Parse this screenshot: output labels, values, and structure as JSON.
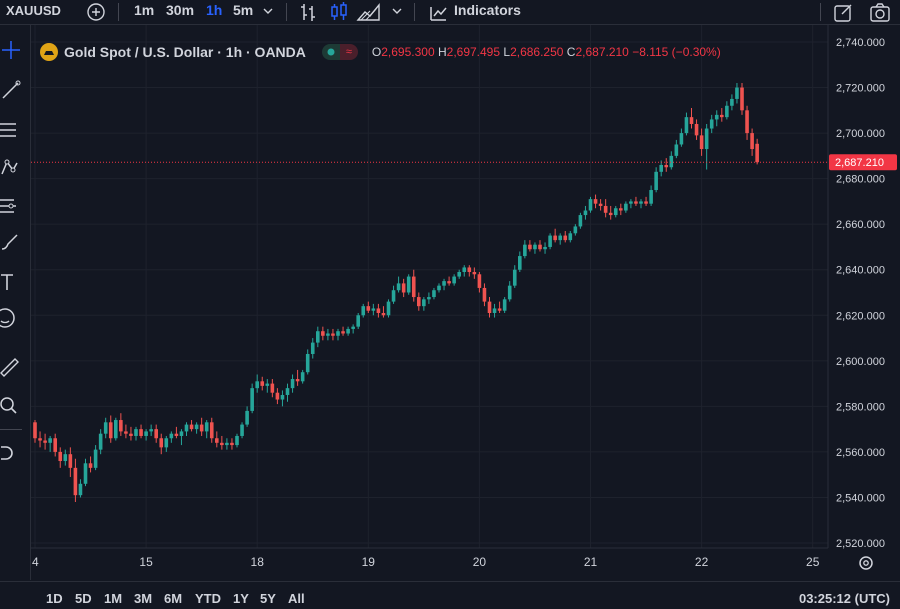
{
  "toolbar": {
    "symbol": "XAUUSD",
    "intervals": [
      "1m",
      "30m",
      "1h",
      "5m"
    ],
    "active_interval": "1h",
    "indicators_label": "Indicators"
  },
  "sidebar": {
    "icons": [
      "crosshair-icon",
      "trend-line-icon",
      "fib-icon",
      "pattern-icon",
      "prediction-icon",
      "brush-icon",
      "text-icon",
      "emoji-icon",
      "ruler-icon",
      "zoom-icon",
      "magnet-icon"
    ]
  },
  "legend": {
    "title": "Gold Spot / U.S. Dollar · 1h · OANDA",
    "o_label": "O",
    "o_value": "2,695.300",
    "h_label": "H",
    "h_value": "2,697.495",
    "l_label": "L",
    "l_value": "2,686.250",
    "c_label": "C",
    "c_value": "2,687.210",
    "change": "−8.115 (−0.30%)",
    "pill_b": "≈"
  },
  "bottom": {
    "ranges": [
      "1D",
      "5D",
      "1M",
      "3M",
      "6M",
      "YTD",
      "1Y",
      "5Y",
      "All"
    ],
    "clock": "03:25:12 (UTC)"
  },
  "colors": {
    "background": "#131722",
    "up": "#26a69a",
    "down": "#ef5350",
    "price_label": "#f23645",
    "text": "#d1d4dc",
    "grid": "#1e222d"
  },
  "chart_data": {
    "type": "candlestick",
    "title": "Gold Spot / U.S. Dollar · 1h · OANDA",
    "ylim": [
      2515,
      2745
    ],
    "y_ticks": [
      2520,
      2540,
      2560,
      2580,
      2600,
      2620,
      2640,
      2660,
      2680,
      2700,
      2720,
      2740
    ],
    "y_tick_labels": [
      "2,520.000",
      "2,540.000",
      "2,560.000",
      "2,580.000",
      "2,600.000",
      "2,620.000",
      "2,640.000",
      "2,660.000",
      "2,680.000",
      "2,700.000",
      "2,720.000",
      "2,740.000"
    ],
    "x_tick_labels": [
      "4",
      "15",
      "18",
      "19",
      "20",
      "21",
      "22",
      "25"
    ],
    "x_tick_index": [
      0,
      22,
      44,
      66,
      88,
      110,
      132,
      154
    ],
    "last_price": 2687.21,
    "last_price_label": "2,687.210",
    "candles": [
      {
        "o": 2573,
        "h": 2574,
        "l": 2564,
        "c": 2566
      },
      {
        "o": 2566,
        "h": 2569,
        "l": 2562,
        "c": 2565
      },
      {
        "o": 2565,
        "h": 2568,
        "l": 2561,
        "c": 2564
      },
      {
        "o": 2564,
        "h": 2567,
        "l": 2560,
        "c": 2566
      },
      {
        "o": 2566,
        "h": 2568,
        "l": 2558,
        "c": 2560
      },
      {
        "o": 2560,
        "h": 2562,
        "l": 2553,
        "c": 2556
      },
      {
        "o": 2556,
        "h": 2561,
        "l": 2554,
        "c": 2559
      },
      {
        "o": 2559,
        "h": 2562,
        "l": 2549,
        "c": 2553
      },
      {
        "o": 2553,
        "h": 2557,
        "l": 2538,
        "c": 2541
      },
      {
        "o": 2541,
        "h": 2548,
        "l": 2540,
        "c": 2546
      },
      {
        "o": 2546,
        "h": 2557,
        "l": 2545,
        "c": 2555
      },
      {
        "o": 2555,
        "h": 2558,
        "l": 2551,
        "c": 2553
      },
      {
        "o": 2553,
        "h": 2563,
        "l": 2552,
        "c": 2561
      },
      {
        "o": 2561,
        "h": 2570,
        "l": 2559,
        "c": 2568
      },
      {
        "o": 2568,
        "h": 2575,
        "l": 2566,
        "c": 2573
      },
      {
        "o": 2573,
        "h": 2576,
        "l": 2564,
        "c": 2566
      },
      {
        "o": 2566,
        "h": 2575,
        "l": 2565,
        "c": 2574
      },
      {
        "o": 2574,
        "h": 2577,
        "l": 2567,
        "c": 2569
      },
      {
        "o": 2569,
        "h": 2572,
        "l": 2566,
        "c": 2568
      },
      {
        "o": 2568,
        "h": 2571,
        "l": 2565,
        "c": 2567
      },
      {
        "o": 2567,
        "h": 2571,
        "l": 2565,
        "c": 2570
      },
      {
        "o": 2570,
        "h": 2572,
        "l": 2566,
        "c": 2567
      },
      {
        "o": 2567,
        "h": 2570,
        "l": 2565,
        "c": 2569
      },
      {
        "o": 2569,
        "h": 2572,
        "l": 2567,
        "c": 2570
      },
      {
        "o": 2570,
        "h": 2572,
        "l": 2564,
        "c": 2566
      },
      {
        "o": 2566,
        "h": 2568,
        "l": 2559,
        "c": 2562
      },
      {
        "o": 2562,
        "h": 2567,
        "l": 2560,
        "c": 2566
      },
      {
        "o": 2566,
        "h": 2569,
        "l": 2564,
        "c": 2568
      },
      {
        "o": 2568,
        "h": 2571,
        "l": 2566,
        "c": 2567
      },
      {
        "o": 2567,
        "h": 2570,
        "l": 2563,
        "c": 2569
      },
      {
        "o": 2569,
        "h": 2573,
        "l": 2567,
        "c": 2572
      },
      {
        "o": 2572,
        "h": 2574,
        "l": 2569,
        "c": 2570
      },
      {
        "o": 2570,
        "h": 2573,
        "l": 2568,
        "c": 2572
      },
      {
        "o": 2572,
        "h": 2575,
        "l": 2567,
        "c": 2569
      },
      {
        "o": 2569,
        "h": 2574,
        "l": 2566,
        "c": 2573
      },
      {
        "o": 2573,
        "h": 2575,
        "l": 2564,
        "c": 2566
      },
      {
        "o": 2566,
        "h": 2569,
        "l": 2562,
        "c": 2564
      },
      {
        "o": 2564,
        "h": 2567,
        "l": 2561,
        "c": 2563
      },
      {
        "o": 2563,
        "h": 2566,
        "l": 2561,
        "c": 2564
      },
      {
        "o": 2564,
        "h": 2566,
        "l": 2561,
        "c": 2563
      },
      {
        "o": 2563,
        "h": 2568,
        "l": 2562,
        "c": 2567
      },
      {
        "o": 2567,
        "h": 2573,
        "l": 2566,
        "c": 2572
      },
      {
        "o": 2572,
        "h": 2580,
        "l": 2571,
        "c": 2578
      },
      {
        "o": 2578,
        "h": 2590,
        "l": 2577,
        "c": 2588
      },
      {
        "o": 2588,
        "h": 2594,
        "l": 2586,
        "c": 2591
      },
      {
        "o": 2591,
        "h": 2593,
        "l": 2587,
        "c": 2589
      },
      {
        "o": 2589,
        "h": 2592,
        "l": 2586,
        "c": 2590
      },
      {
        "o": 2590,
        "h": 2592,
        "l": 2584,
        "c": 2586
      },
      {
        "o": 2586,
        "h": 2588,
        "l": 2581,
        "c": 2583
      },
      {
        "o": 2583,
        "h": 2587,
        "l": 2580,
        "c": 2585
      },
      {
        "o": 2585,
        "h": 2590,
        "l": 2582,
        "c": 2588
      },
      {
        "o": 2588,
        "h": 2594,
        "l": 2586,
        "c": 2592
      },
      {
        "o": 2592,
        "h": 2596,
        "l": 2589,
        "c": 2591
      },
      {
        "o": 2591,
        "h": 2596,
        "l": 2590,
        "c": 2595
      },
      {
        "o": 2595,
        "h": 2605,
        "l": 2594,
        "c": 2603
      },
      {
        "o": 2603,
        "h": 2610,
        "l": 2601,
        "c": 2608
      },
      {
        "o": 2608,
        "h": 2615,
        "l": 2606,
        "c": 2613
      },
      {
        "o": 2613,
        "h": 2615,
        "l": 2609,
        "c": 2611
      },
      {
        "o": 2611,
        "h": 2614,
        "l": 2609,
        "c": 2612
      },
      {
        "o": 2612,
        "h": 2614,
        "l": 2609,
        "c": 2611
      },
      {
        "o": 2611,
        "h": 2614,
        "l": 2609,
        "c": 2613
      },
      {
        "o": 2613,
        "h": 2615,
        "l": 2611,
        "c": 2612
      },
      {
        "o": 2612,
        "h": 2615,
        "l": 2611,
        "c": 2614
      },
      {
        "o": 2614,
        "h": 2616,
        "l": 2612,
        "c": 2615
      },
      {
        "o": 2615,
        "h": 2621,
        "l": 2614,
        "c": 2620
      },
      {
        "o": 2620,
        "h": 2625,
        "l": 2619,
        "c": 2624
      },
      {
        "o": 2624,
        "h": 2626,
        "l": 2621,
        "c": 2622
      },
      {
        "o": 2622,
        "h": 2625,
        "l": 2620,
        "c": 2623
      },
      {
        "o": 2623,
        "h": 2625,
        "l": 2619,
        "c": 2621
      },
      {
        "o": 2621,
        "h": 2624,
        "l": 2619,
        "c": 2620
      },
      {
        "o": 2620,
        "h": 2627,
        "l": 2619,
        "c": 2626
      },
      {
        "o": 2626,
        "h": 2633,
        "l": 2625,
        "c": 2631
      },
      {
        "o": 2631,
        "h": 2637,
        "l": 2630,
        "c": 2634
      },
      {
        "o": 2634,
        "h": 2636,
        "l": 2628,
        "c": 2630
      },
      {
        "o": 2630,
        "h": 2638,
        "l": 2629,
        "c": 2637
      },
      {
        "o": 2637,
        "h": 2640,
        "l": 2626,
        "c": 2628
      },
      {
        "o": 2628,
        "h": 2630,
        "l": 2622,
        "c": 2624
      },
      {
        "o": 2624,
        "h": 2628,
        "l": 2622,
        "c": 2627
      },
      {
        "o": 2627,
        "h": 2630,
        "l": 2625,
        "c": 2628
      },
      {
        "o": 2628,
        "h": 2632,
        "l": 2627,
        "c": 2631
      },
      {
        "o": 2631,
        "h": 2634,
        "l": 2630,
        "c": 2633
      },
      {
        "o": 2633,
        "h": 2636,
        "l": 2631,
        "c": 2635
      },
      {
        "o": 2635,
        "h": 2637,
        "l": 2633,
        "c": 2634
      },
      {
        "o": 2634,
        "h": 2638,
        "l": 2633,
        "c": 2637
      },
      {
        "o": 2637,
        "h": 2640,
        "l": 2636,
        "c": 2639
      },
      {
        "o": 2639,
        "h": 2642,
        "l": 2637,
        "c": 2641
      },
      {
        "o": 2641,
        "h": 2642,
        "l": 2637,
        "c": 2639
      },
      {
        "o": 2639,
        "h": 2641,
        "l": 2636,
        "c": 2638
      },
      {
        "o": 2638,
        "h": 2639,
        "l": 2630,
        "c": 2632
      },
      {
        "o": 2632,
        "h": 2634,
        "l": 2624,
        "c": 2626
      },
      {
        "o": 2626,
        "h": 2628,
        "l": 2619,
        "c": 2621
      },
      {
        "o": 2621,
        "h": 2625,
        "l": 2619,
        "c": 2623
      },
      {
        "o": 2623,
        "h": 2626,
        "l": 2621,
        "c": 2622
      },
      {
        "o": 2622,
        "h": 2628,
        "l": 2621,
        "c": 2627
      },
      {
        "o": 2627,
        "h": 2635,
        "l": 2626,
        "c": 2633
      },
      {
        "o": 2633,
        "h": 2642,
        "l": 2632,
        "c": 2640
      },
      {
        "o": 2640,
        "h": 2648,
        "l": 2639,
        "c": 2646
      },
      {
        "o": 2646,
        "h": 2653,
        "l": 2645,
        "c": 2651
      },
      {
        "o": 2651,
        "h": 2653,
        "l": 2648,
        "c": 2649
      },
      {
        "o": 2649,
        "h": 2652,
        "l": 2647,
        "c": 2651
      },
      {
        "o": 2651,
        "h": 2653,
        "l": 2648,
        "c": 2649
      },
      {
        "o": 2649,
        "h": 2652,
        "l": 2647,
        "c": 2650
      },
      {
        "o": 2650,
        "h": 2656,
        "l": 2649,
        "c": 2655
      },
      {
        "o": 2655,
        "h": 2658,
        "l": 2652,
        "c": 2653
      },
      {
        "o": 2653,
        "h": 2656,
        "l": 2651,
        "c": 2655
      },
      {
        "o": 2655,
        "h": 2657,
        "l": 2652,
        "c": 2653
      },
      {
        "o": 2653,
        "h": 2657,
        "l": 2652,
        "c": 2656
      },
      {
        "o": 2656,
        "h": 2660,
        "l": 2655,
        "c": 2659
      },
      {
        "o": 2659,
        "h": 2665,
        "l": 2658,
        "c": 2664
      },
      {
        "o": 2664,
        "h": 2668,
        "l": 2662,
        "c": 2666
      },
      {
        "o": 2666,
        "h": 2672,
        "l": 2665,
        "c": 2671
      },
      {
        "o": 2671,
        "h": 2673,
        "l": 2667,
        "c": 2669
      },
      {
        "o": 2669,
        "h": 2671,
        "l": 2666,
        "c": 2668
      },
      {
        "o": 2668,
        "h": 2671,
        "l": 2663,
        "c": 2665
      },
      {
        "o": 2665,
        "h": 2668,
        "l": 2662,
        "c": 2664
      },
      {
        "o": 2664,
        "h": 2668,
        "l": 2663,
        "c": 2667
      },
      {
        "o": 2667,
        "h": 2669,
        "l": 2664,
        "c": 2666
      },
      {
        "o": 2666,
        "h": 2670,
        "l": 2665,
        "c": 2669
      },
      {
        "o": 2669,
        "h": 2671,
        "l": 2667,
        "c": 2670
      },
      {
        "o": 2670,
        "h": 2672,
        "l": 2668,
        "c": 2669
      },
      {
        "o": 2669,
        "h": 2671,
        "l": 2667,
        "c": 2670
      },
      {
        "o": 2670,
        "h": 2672,
        "l": 2668,
        "c": 2669
      },
      {
        "o": 2669,
        "h": 2677,
        "l": 2668,
        "c": 2675
      },
      {
        "o": 2675,
        "h": 2685,
        "l": 2674,
        "c": 2683
      },
      {
        "o": 2683,
        "h": 2688,
        "l": 2681,
        "c": 2686
      },
      {
        "o": 2686,
        "h": 2689,
        "l": 2683,
        "c": 2685
      },
      {
        "o": 2685,
        "h": 2692,
        "l": 2684,
        "c": 2690
      },
      {
        "o": 2690,
        "h": 2697,
        "l": 2689,
        "c": 2695
      },
      {
        "o": 2695,
        "h": 2702,
        "l": 2694,
        "c": 2700
      },
      {
        "o": 2700,
        "h": 2709,
        "l": 2699,
        "c": 2707
      },
      {
        "o": 2707,
        "h": 2711,
        "l": 2702,
        "c": 2704
      },
      {
        "o": 2704,
        "h": 2706,
        "l": 2697,
        "c": 2699
      },
      {
        "o": 2699,
        "h": 2702,
        "l": 2690,
        "c": 2693
      },
      {
        "o": 2693,
        "h": 2704,
        "l": 2684,
        "c": 2702
      },
      {
        "o": 2702,
        "h": 2708,
        "l": 2700,
        "c": 2706
      },
      {
        "o": 2706,
        "h": 2710,
        "l": 2703,
        "c": 2708
      },
      {
        "o": 2708,
        "h": 2711,
        "l": 2705,
        "c": 2707
      },
      {
        "o": 2707,
        "h": 2714,
        "l": 2706,
        "c": 2712
      },
      {
        "o": 2712,
        "h": 2717,
        "l": 2710,
        "c": 2715
      },
      {
        "o": 2715,
        "h": 2722,
        "l": 2713,
        "c": 2720
      },
      {
        "o": 2720,
        "h": 2722,
        "l": 2708,
        "c": 2710
      },
      {
        "o": 2710,
        "h": 2712,
        "l": 2697,
        "c": 2700
      },
      {
        "o": 2700,
        "h": 2702,
        "l": 2690,
        "c": 2693
      },
      {
        "o": 2695.3,
        "h": 2697.495,
        "l": 2686.25,
        "c": 2687.21
      }
    ]
  }
}
